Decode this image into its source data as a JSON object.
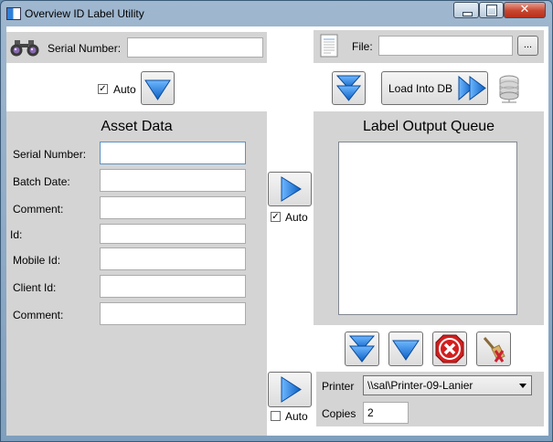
{
  "window": {
    "title": "Overview ID Label Utility"
  },
  "top": {
    "serial_label": "Serial Number:",
    "serial_value": "",
    "file_label": "File:",
    "file_value": "",
    "browse_label": "..."
  },
  "auto_left": {
    "label": "Auto",
    "checked": true
  },
  "load_button_label": "Load Into DB",
  "asset": {
    "title": "Asset Data",
    "fields": [
      {
        "label": "Serial Number:",
        "value": ""
      },
      {
        "label": "Batch Date:",
        "value": ""
      },
      {
        "label": "Comment:",
        "value": ""
      },
      {
        "label": "Id:",
        "value": ""
      },
      {
        "label": "Mobile Id:",
        "value": ""
      },
      {
        "label": "Client Id:",
        "value": ""
      },
      {
        "label": "Comment:",
        "value": ""
      }
    ]
  },
  "auto_middle": {
    "label": "Auto",
    "checked": true
  },
  "queue": {
    "title": "Label Output Queue",
    "items": []
  },
  "auto_bottom": {
    "label": "Auto",
    "checked": false
  },
  "printer": {
    "label": "Printer",
    "selected": "\\\\sal\\Printer-09-Lanier"
  },
  "copies": {
    "label": "Copies",
    "value": "2"
  },
  "icons": {
    "binoculars": "binoculars-icon",
    "document": "document-icon",
    "database": "database-icon",
    "arrow_color": "#1e7fe0"
  }
}
